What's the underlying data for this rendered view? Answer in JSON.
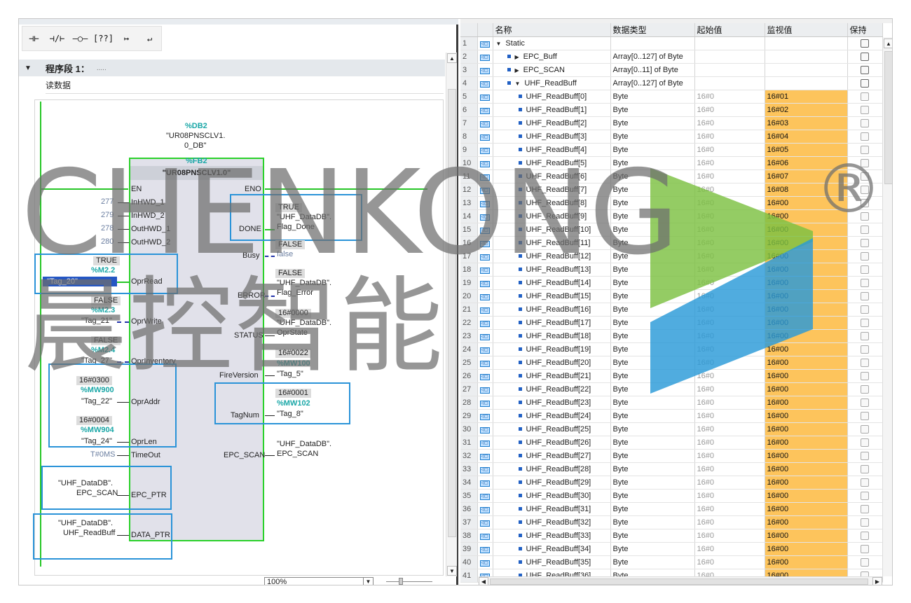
{
  "toolbar": {
    "buttons": [
      {
        "label": "⊣⊢",
        "icon": "no-contact-icon"
      },
      {
        "label": "⊣/⊢",
        "icon": "nc-contact-icon"
      },
      {
        "label": "–○–",
        "icon": "coil-icon"
      },
      {
        "label": "[??]",
        "icon": "empty-box-icon"
      },
      {
        "label": "↦",
        "icon": "open-branch-icon"
      },
      {
        "label": "↵",
        "icon": "close-branch-icon"
      }
    ]
  },
  "segment": {
    "title": "程序段 1：",
    "dots": ".....",
    "comment": "读数据"
  },
  "block": {
    "db_ref": "%DB2",
    "db_name_1": "\"UR08PNSCLV1.",
    "db_name_2": "0_DB\"",
    "fb_ref": "%FB2",
    "fb_name": "\"UR08PNSCLV1.0\"",
    "en": "EN",
    "eno": "ENO",
    "inputs": {
      "inhwd1": {
        "pin": "InHWD_1",
        "value": "277"
      },
      "inhwd2": {
        "pin": "InHWD_2",
        "value": "279"
      },
      "outhwd1": {
        "pin": "OutHWD_1",
        "value": "278"
      },
      "outhwd2": {
        "pin": "OutHWD_2",
        "value": "280"
      },
      "oprread": {
        "pin": "OprRead",
        "status": "TRUE",
        "addr": "%M2.2",
        "tag": "\"Tag_20\""
      },
      "oprwrite": {
        "pin": "OprWrite",
        "status": "FALSE",
        "addr": "%M2.3",
        "tag": "\"Tag_21\""
      },
      "oprinv": {
        "pin": "OprInventory",
        "status": "FALSE",
        "addr": "%M2.4",
        "tag": "\"Tag_27\""
      },
      "opraddr": {
        "pin": "OprAddr",
        "status": "16#0300",
        "addr": "%MW900",
        "tag": "\"Tag_22\""
      },
      "oprlen": {
        "pin": "OprLen",
        "status": "16#0004",
        "addr": "%MW904",
        "tag": "\"Tag_24\""
      },
      "timeout": {
        "pin": "TimeOut",
        "value": "T#0MS"
      },
      "epcptr": {
        "pin": "EPC_PTR",
        "line1": "\"UHF_DataDB\".",
        "line2": "EPC_SCAN"
      },
      "dataptr": {
        "pin": "DATA_PTR",
        "line1": "\"UHF_DataDB\".",
        "line2": "UHF_ReadBuff"
      }
    },
    "outputs": {
      "done": {
        "pin": "DONE",
        "status": "TRUE",
        "line1": "\"UHF_DataDB\".",
        "line2": "Flag_Done"
      },
      "busy": {
        "pin": "Busy",
        "status": "FALSE",
        "line1": "false"
      },
      "error": {
        "pin": "ERROR",
        "status": "FALSE",
        "line1": "\"UHF_DataDB\".",
        "line2": "Flag_Error"
      },
      "status": {
        "pin": "STATUS",
        "status": "16#0000",
        "line1": "\"UHF_DataDB\".",
        "line2": "OprState"
      },
      "fireversion": {
        "pin": "FireVersion",
        "status": "16#0022",
        "addr": "%MW100",
        "tag": "\"Tag_5\""
      },
      "tagnum": {
        "pin": "TagNum",
        "status": "16#0001",
        "addr": "%MW102",
        "tag": "\"Tag_8\""
      },
      "epcscan": {
        "pin": "EPC_SCAN",
        "line1": "\"UHF_DataDB\".",
        "line2": "EPC_SCAN"
      }
    }
  },
  "zoom": {
    "value": "100%"
  },
  "table": {
    "headers": {
      "name": "名称",
      "type": "数据类型",
      "start": "起始值",
      "monitor": "监视值",
      "retain": "保持"
    },
    "rows": [
      {
        "n": "1",
        "name": "Static",
        "type": "",
        "start": "",
        "mon": "",
        "level": 0,
        "expander": "down"
      },
      {
        "n": "2",
        "name": "EPC_Buff",
        "type": "Array[0..127] of Byte",
        "start": "",
        "mon": "",
        "level": 1,
        "expander": "right"
      },
      {
        "n": "3",
        "name": "EPC_SCAN",
        "type": "Array[0..11] of Byte",
        "start": "",
        "mon": "",
        "level": 1,
        "expander": "right"
      },
      {
        "n": "4",
        "name": "UHF_ReadBuff",
        "type": "Array[0..127] of Byte",
        "start": "",
        "mon": "",
        "level": 1,
        "expander": "down"
      },
      {
        "n": "5",
        "name": "UHF_ReadBuff[0]",
        "type": "Byte",
        "start": "16#0",
        "mon": "16#01",
        "level": 2
      },
      {
        "n": "6",
        "name": "UHF_ReadBuff[1]",
        "type": "Byte",
        "start": "16#0",
        "mon": "16#02",
        "level": 2
      },
      {
        "n": "7",
        "name": "UHF_ReadBuff[2]",
        "type": "Byte",
        "start": "16#0",
        "mon": "16#03",
        "level": 2
      },
      {
        "n": "8",
        "name": "UHF_ReadBuff[3]",
        "type": "Byte",
        "start": "16#0",
        "mon": "16#04",
        "level": 2
      },
      {
        "n": "9",
        "name": "UHF_ReadBuff[4]",
        "type": "Byte",
        "start": "16#0",
        "mon": "16#05",
        "level": 2
      },
      {
        "n": "10",
        "name": "UHF_ReadBuff[5]",
        "type": "Byte",
        "start": "16#0",
        "mon": "16#06",
        "level": 2
      },
      {
        "n": "11",
        "name": "UHF_ReadBuff[6]",
        "type": "Byte",
        "start": "16#0",
        "mon": "16#07",
        "level": 2
      },
      {
        "n": "12",
        "name": "UHF_ReadBuff[7]",
        "type": "Byte",
        "start": "16#0",
        "mon": "16#08",
        "level": 2
      },
      {
        "n": "13",
        "name": "UHF_ReadBuff[8]",
        "type": "Byte",
        "start": "16#0",
        "mon": "16#00",
        "level": 2
      },
      {
        "n": "14",
        "name": "UHF_ReadBuff[9]",
        "type": "Byte",
        "start": "16#0",
        "mon": "16#00",
        "level": 2
      },
      {
        "n": "15",
        "name": "UHF_ReadBuff[10]",
        "type": "Byte",
        "start": "16#0",
        "mon": "16#00",
        "level": 2
      },
      {
        "n": "16",
        "name": "UHF_ReadBuff[11]",
        "type": "Byte",
        "start": "16#0",
        "mon": "16#00",
        "level": 2
      },
      {
        "n": "17",
        "name": "UHF_ReadBuff[12]",
        "type": "Byte",
        "start": "16#0",
        "mon": "16#00",
        "level": 2
      },
      {
        "n": "18",
        "name": "UHF_ReadBuff[13]",
        "type": "Byte",
        "start": "16#0",
        "mon": "16#00",
        "level": 2
      },
      {
        "n": "19",
        "name": "UHF_ReadBuff[14]",
        "type": "Byte",
        "start": "16#0",
        "mon": "16#00",
        "level": 2
      },
      {
        "n": "20",
        "name": "UHF_ReadBuff[15]",
        "type": "Byte",
        "start": "16#0",
        "mon": "16#00",
        "level": 2
      },
      {
        "n": "21",
        "name": "UHF_ReadBuff[16]",
        "type": "Byte",
        "start": "16#0",
        "mon": "16#00",
        "level": 2
      },
      {
        "n": "22",
        "name": "UHF_ReadBuff[17]",
        "type": "Byte",
        "start": "16#0",
        "mon": "16#00",
        "level": 2
      },
      {
        "n": "23",
        "name": "UHF_ReadBuff[18]",
        "type": "Byte",
        "start": "16#0",
        "mon": "16#00",
        "level": 2
      },
      {
        "n": "24",
        "name": "UHF_ReadBuff[19]",
        "type": "Byte",
        "start": "16#0",
        "mon": "16#00",
        "level": 2
      },
      {
        "n": "25",
        "name": "UHF_ReadBuff[20]",
        "type": "Byte",
        "start": "16#0",
        "mon": "16#00",
        "level": 2
      },
      {
        "n": "26",
        "name": "UHF_ReadBuff[21]",
        "type": "Byte",
        "start": "16#0",
        "mon": "16#00",
        "level": 2
      },
      {
        "n": "27",
        "name": "UHF_ReadBuff[22]",
        "type": "Byte",
        "start": "16#0",
        "mon": "16#00",
        "level": 2
      },
      {
        "n": "28",
        "name": "UHF_ReadBuff[23]",
        "type": "Byte",
        "start": "16#0",
        "mon": "16#00",
        "level": 2
      },
      {
        "n": "29",
        "name": "UHF_ReadBuff[24]",
        "type": "Byte",
        "start": "16#0",
        "mon": "16#00",
        "level": 2
      },
      {
        "n": "30",
        "name": "UHF_ReadBuff[25]",
        "type": "Byte",
        "start": "16#0",
        "mon": "16#00",
        "level": 2
      },
      {
        "n": "31",
        "name": "UHF_ReadBuff[26]",
        "type": "Byte",
        "start": "16#0",
        "mon": "16#00",
        "level": 2
      },
      {
        "n": "32",
        "name": "UHF_ReadBuff[27]",
        "type": "Byte",
        "start": "16#0",
        "mon": "16#00",
        "level": 2
      },
      {
        "n": "33",
        "name": "UHF_ReadBuff[28]",
        "type": "Byte",
        "start": "16#0",
        "mon": "16#00",
        "level": 2
      },
      {
        "n": "34",
        "name": "UHF_ReadBuff[29]",
        "type": "Byte",
        "start": "16#0",
        "mon": "16#00",
        "level": 2
      },
      {
        "n": "35",
        "name": "UHF_ReadBuff[30]",
        "type": "Byte",
        "start": "16#0",
        "mon": "16#00",
        "level": 2
      },
      {
        "n": "36",
        "name": "UHF_ReadBuff[31]",
        "type": "Byte",
        "start": "16#0",
        "mon": "16#00",
        "level": 2
      },
      {
        "n": "37",
        "name": "UHF_ReadBuff[32]",
        "type": "Byte",
        "start": "16#0",
        "mon": "16#00",
        "level": 2
      },
      {
        "n": "38",
        "name": "UHF_ReadBuff[33]",
        "type": "Byte",
        "start": "16#0",
        "mon": "16#00",
        "level": 2
      },
      {
        "n": "39",
        "name": "UHF_ReadBuff[34]",
        "type": "Byte",
        "start": "16#0",
        "mon": "16#00",
        "level": 2
      },
      {
        "n": "40",
        "name": "UHF_ReadBuff[35]",
        "type": "Byte",
        "start": "16#0",
        "mon": "16#00",
        "level": 2
      },
      {
        "n": "41",
        "name": "UHF_ReadBuff[36]",
        "type": "Byte",
        "start": "16#0",
        "mon": "16#00",
        "level": 2
      }
    ]
  },
  "watermark": {
    "latin": "CHENKONG",
    "chinese": "晨控智能",
    "registered": "®"
  },
  "colors": {
    "monitor": "#fdc45c",
    "power_flow": "#27c627",
    "selection": "#2456c4",
    "box_outline": "#2a93d8",
    "logo_green": "#7dc142",
    "logo_blue": "#2a9ad8"
  }
}
